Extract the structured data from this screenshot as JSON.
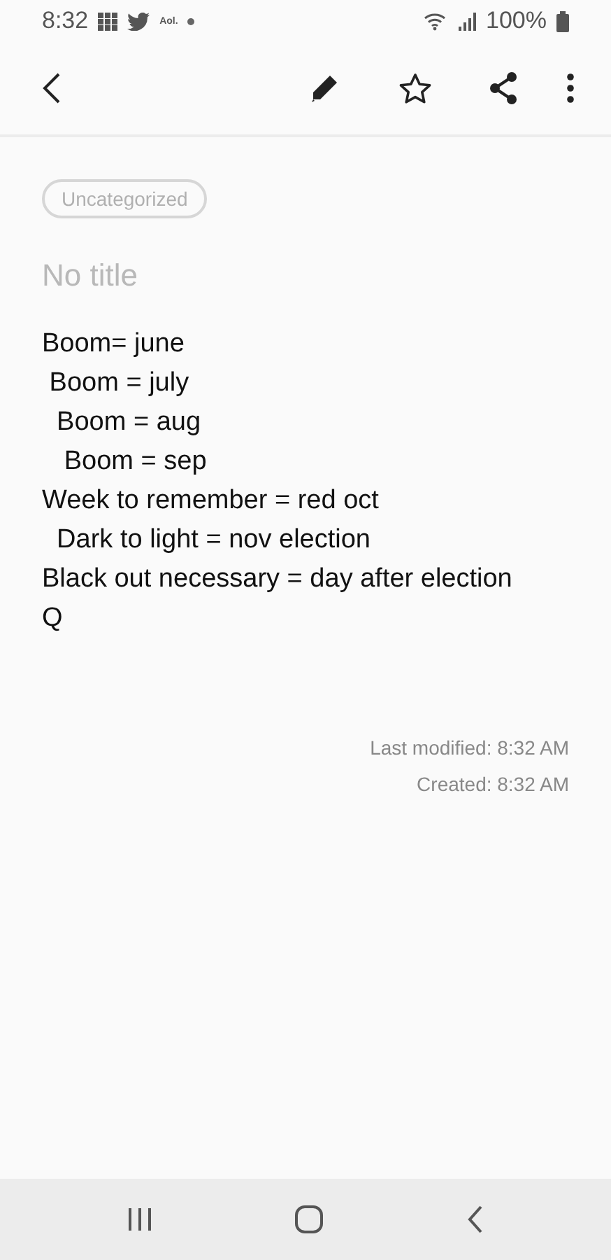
{
  "status_bar": {
    "time": "8:32",
    "notification_text": "Aol.",
    "battery": "100%"
  },
  "note": {
    "category": "Uncategorized",
    "title_placeholder": "No title",
    "lines": [
      "Boom= june",
      " Boom = july",
      "  Boom = aug",
      "   Boom = sep",
      "Week to remember = red oct",
      "  Dark to light = nov election",
      "Black out necessary = day after election",
      "Q"
    ],
    "last_modified": "Last modified: 8:32 AM",
    "created": "Created: 8:32 AM"
  }
}
